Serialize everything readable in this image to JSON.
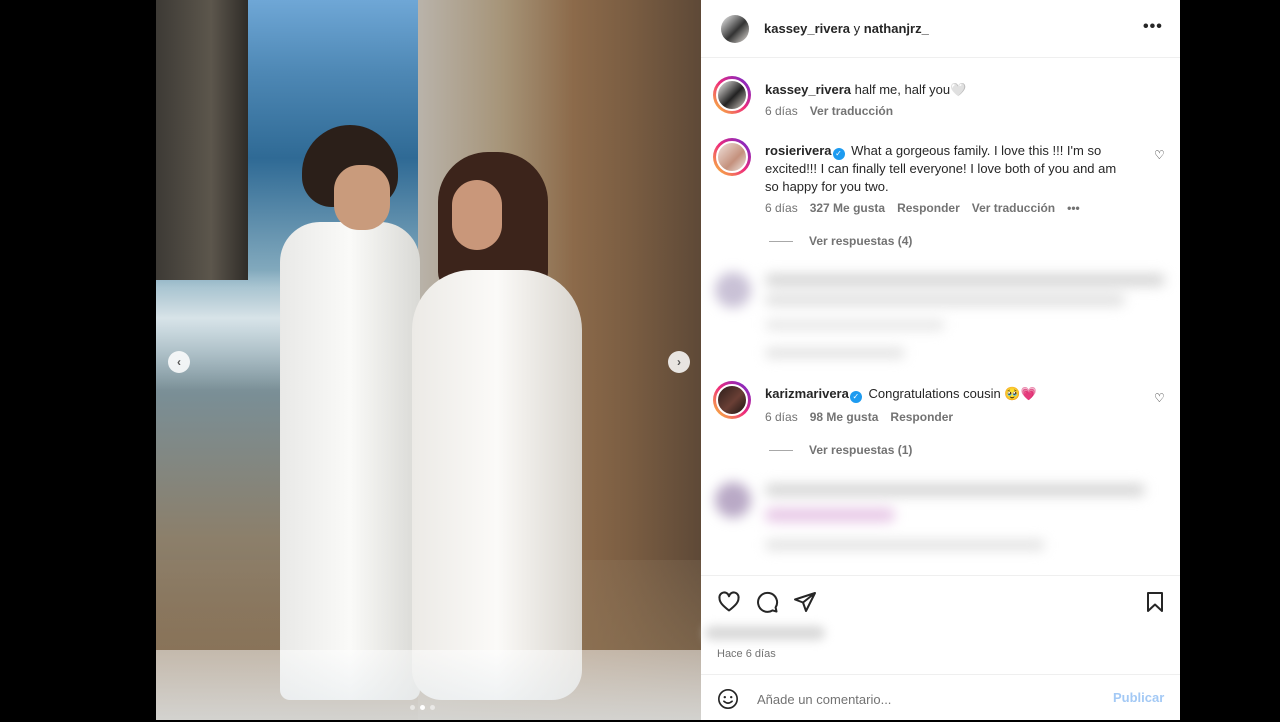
{
  "post": {
    "header": {
      "user1": "kassey_rivera",
      "separator": "y",
      "user2": "nathanjrz_",
      "more_icon": "•••"
    },
    "carousel": {
      "prev_icon": "‹",
      "next_icon": "›",
      "slide_count": 3,
      "active_slide": 2
    },
    "caption": {
      "username": "kassey_rivera",
      "text": "half me, half you🤍",
      "time": "6 días",
      "translate": "Ver traducción"
    },
    "comments": [
      {
        "username": "rosierivera",
        "verified": true,
        "text": "What a gorgeous family. I love this !!! I'm so excited!!! I can finally tell everyone! I love both of you and am so happy for you two.",
        "time": "6 días",
        "likes": "327 Me gusta",
        "reply": "Responder",
        "translate": "Ver traducción",
        "more_icon": "•••",
        "view_replies": "Ver respuestas (4)"
      },
      {
        "username": "karizmarivera",
        "verified": true,
        "text": "Congratulations cousin 🥹💗",
        "time": "6 días",
        "likes": "98 Me gusta",
        "reply": "Responder",
        "view_replies": "Ver respuestas (1)"
      }
    ],
    "footer": {
      "timestamp": "Hace 6 días",
      "comment_placeholder": "Añade un comentario...",
      "publish": "Publicar"
    }
  },
  "colors": {
    "verified": "#1d9bf0",
    "publish_disabled": "#a3c9f5",
    "muted_text": "#737373"
  }
}
